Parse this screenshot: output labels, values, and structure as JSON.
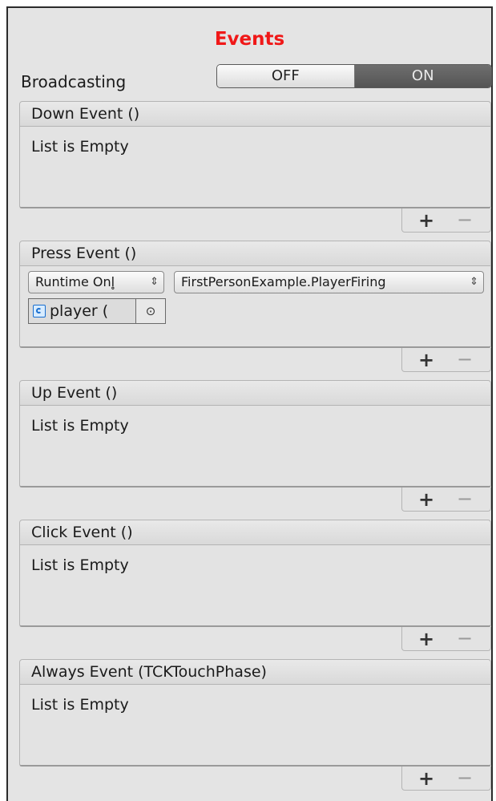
{
  "inspector": {
    "title": "Events",
    "broadcasting": {
      "label": "Broadcasting",
      "off_label": "OFF",
      "on_label": "ON",
      "selected": "ON"
    },
    "plus_label": "+",
    "minus_label": "−",
    "events": {
      "down": {
        "header": "Down Event ()",
        "empty_text": "List is Empty"
      },
      "press": {
        "header": "Press Event ()",
        "runtime_select": "Runtime Onl̥",
        "function_select": "FirstPersonExample.PlayerFiring",
        "object_field": "player (",
        "picker_glyph": "⊙",
        "select_arrow": "⇕"
      },
      "up": {
        "header": "Up Event ()",
        "empty_text": "List is Empty"
      },
      "click": {
        "header": "Click Event ()",
        "empty_text": "List is Empty"
      },
      "always": {
        "header": "Always Event (TCKTouchPhase)",
        "empty_text": "List is Empty"
      }
    }
  }
}
